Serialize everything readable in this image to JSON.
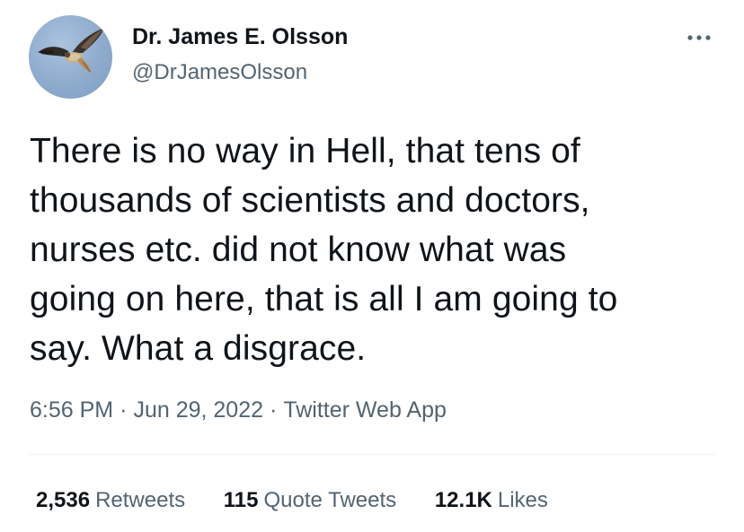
{
  "author": {
    "display_name": "Dr. James E. Olsson",
    "handle": "@DrJamesOlsson",
    "avatar_icon": "hawk-avatar"
  },
  "menu": {
    "more_icon": "more-horizontal-icon"
  },
  "tweet": {
    "text_lines": [
      "There is no way in Hell, that tens of",
      "thousands of scientists and doctors,",
      "nurses etc. did not know what was",
      "going on here, that is all I am going to",
      "say. What a disgrace."
    ]
  },
  "meta": {
    "time": "6:56 PM",
    "date": "Jun 29, 2022",
    "source": "Twitter Web App",
    "separator": "·"
  },
  "stats": {
    "retweets_count": "2,536",
    "retweets_label": "Retweets",
    "quotes_count": "115",
    "quotes_label": "Quote Tweets",
    "likes_count": "12.1K",
    "likes_label": "Likes"
  },
  "colors": {
    "text": "#0f1419",
    "secondary": "#536471",
    "divider": "#eff3f4",
    "avatar_sky": "#8eabcd"
  }
}
